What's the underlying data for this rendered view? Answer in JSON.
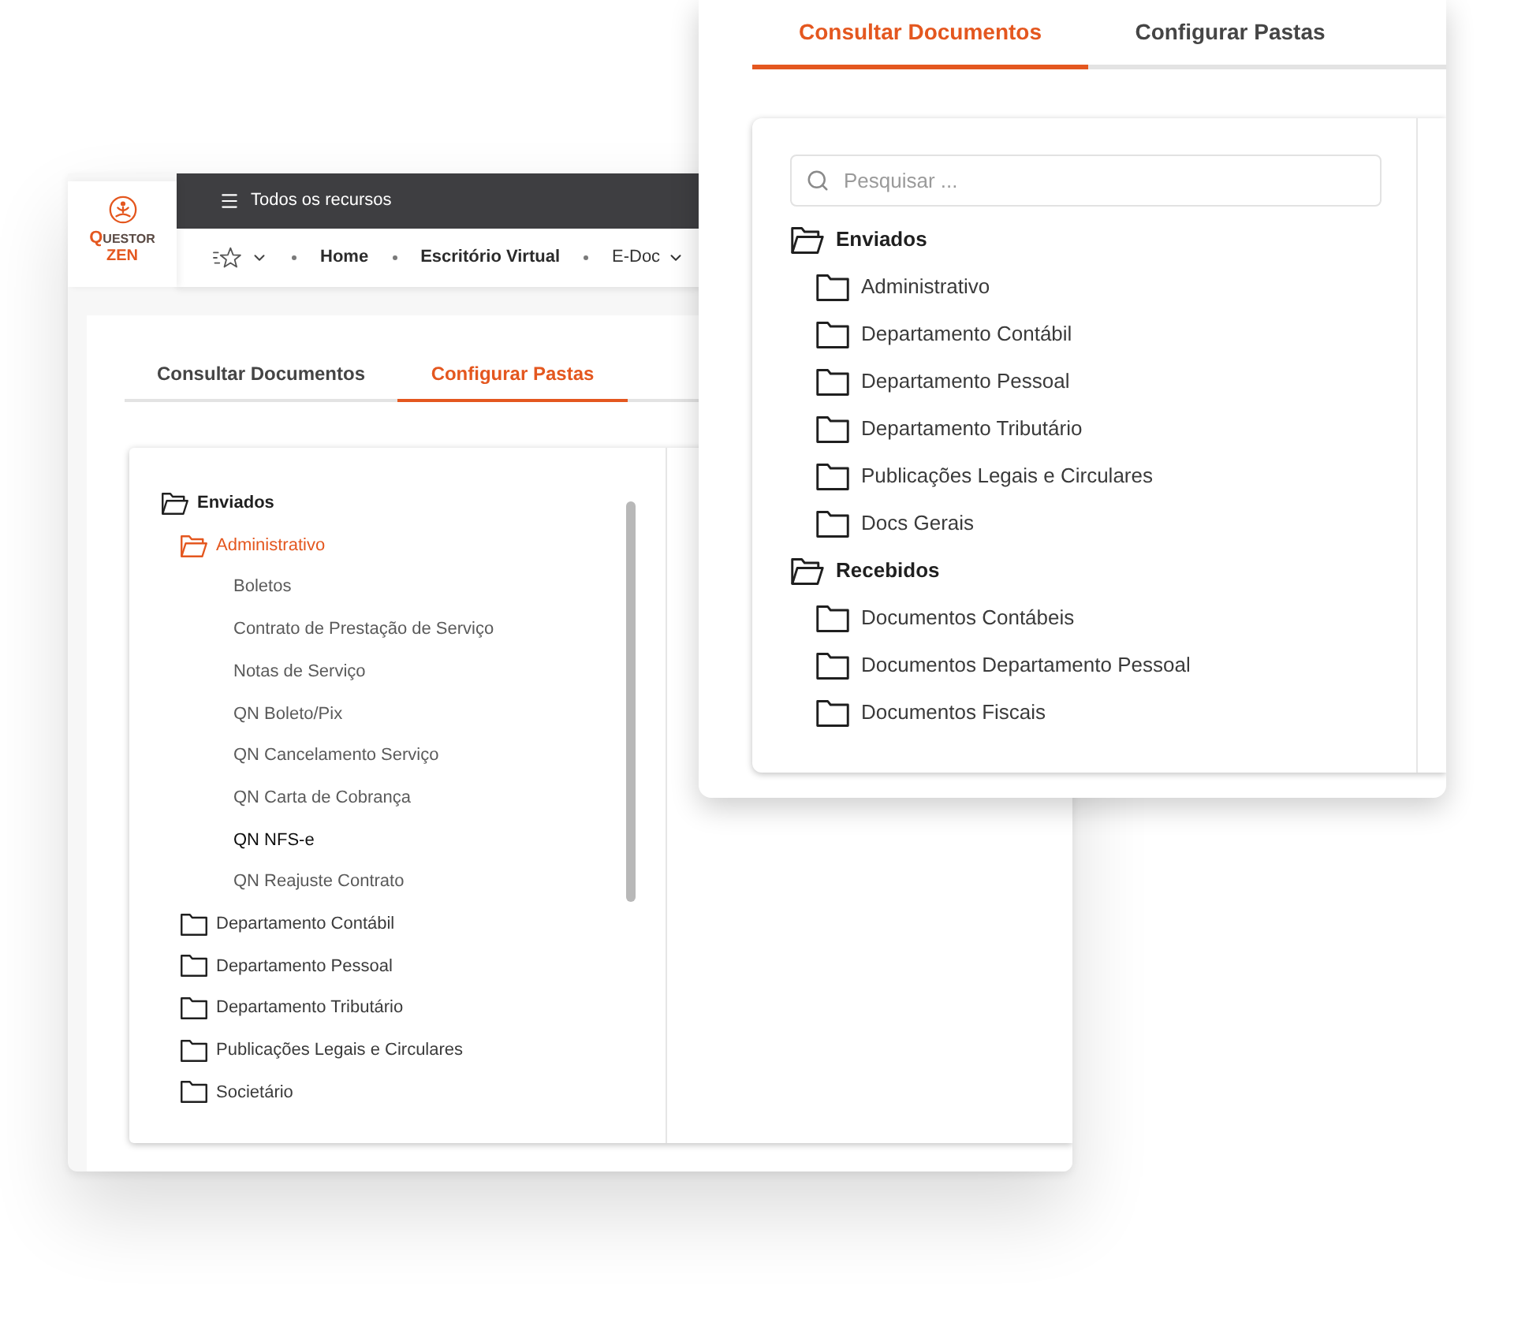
{
  "back_window": {
    "logo": {
      "name": "QUESTOR",
      "tagline": "ZEN"
    },
    "top_bar": {
      "menu_label": "Todos os recursos"
    },
    "breadcrumb": [
      {
        "label": "Home",
        "kind": "link"
      },
      {
        "label": "Escritório Virtual",
        "kind": "link"
      },
      {
        "label": "E-Doc",
        "kind": "menu"
      }
    ],
    "tabs": [
      {
        "label": "Consultar Documentos",
        "selected": false
      },
      {
        "label": "Configurar Pastas",
        "selected": true
      }
    ],
    "tree": [
      {
        "label": "Enviados",
        "expanded": true,
        "selected": false,
        "children": [
          {
            "label": "Administrativo",
            "expanded": true,
            "selected": true,
            "children": [
              {
                "label": "Boletos",
                "hovered": false
              },
              {
                "label": "Contrato de Prestação de Serviço",
                "hovered": false
              },
              {
                "label": "Notas de Serviço",
                "hovered": false
              },
              {
                "label": "QN Boleto/Pix",
                "hovered": false
              },
              {
                "label": "QN Cancelamento Serviço",
                "hovered": false
              },
              {
                "label": "QN Carta de Cobrança",
                "hovered": false
              },
              {
                "label": "QN NFS-e",
                "hovered": true
              },
              {
                "label": "QN Reajuste Contrato",
                "hovered": false
              }
            ]
          },
          {
            "label": "Departamento Contábil",
            "expanded": false,
            "selected": false
          },
          {
            "label": "Departamento Pessoal",
            "expanded": false,
            "selected": false
          },
          {
            "label": "Departamento Tributário",
            "expanded": false,
            "selected": false
          },
          {
            "label": "Publicações Legais e Circulares",
            "expanded": false,
            "selected": false
          },
          {
            "label": "Societário",
            "expanded": false,
            "selected": false
          }
        ]
      }
    ]
  },
  "front_window": {
    "tabs": [
      {
        "label": "Consultar Documentos",
        "selected": true
      },
      {
        "label": "Configurar Pastas",
        "selected": false
      }
    ],
    "search": {
      "placeholder": "Pesquisar ..."
    },
    "tree": [
      {
        "label": "Enviados",
        "expanded": true,
        "children": [
          {
            "label": "Administrativo",
            "expanded": false
          },
          {
            "label": "Departamento Contábil",
            "expanded": false
          },
          {
            "label": "Departamento Pessoal",
            "expanded": false
          },
          {
            "label": "Departamento Tributário",
            "expanded": false
          },
          {
            "label": "Publicações Legais e Circulares",
            "expanded": false
          },
          {
            "label": "Docs Gerais",
            "expanded": false
          }
        ]
      },
      {
        "label": "Recebidos",
        "expanded": true,
        "children": [
          {
            "label": "Documentos Contábeis",
            "expanded": false
          },
          {
            "label": "Documentos Departamento Pessoal",
            "expanded": false
          },
          {
            "label": "Documentos Fiscais",
            "expanded": false
          }
        ]
      }
    ]
  }
}
